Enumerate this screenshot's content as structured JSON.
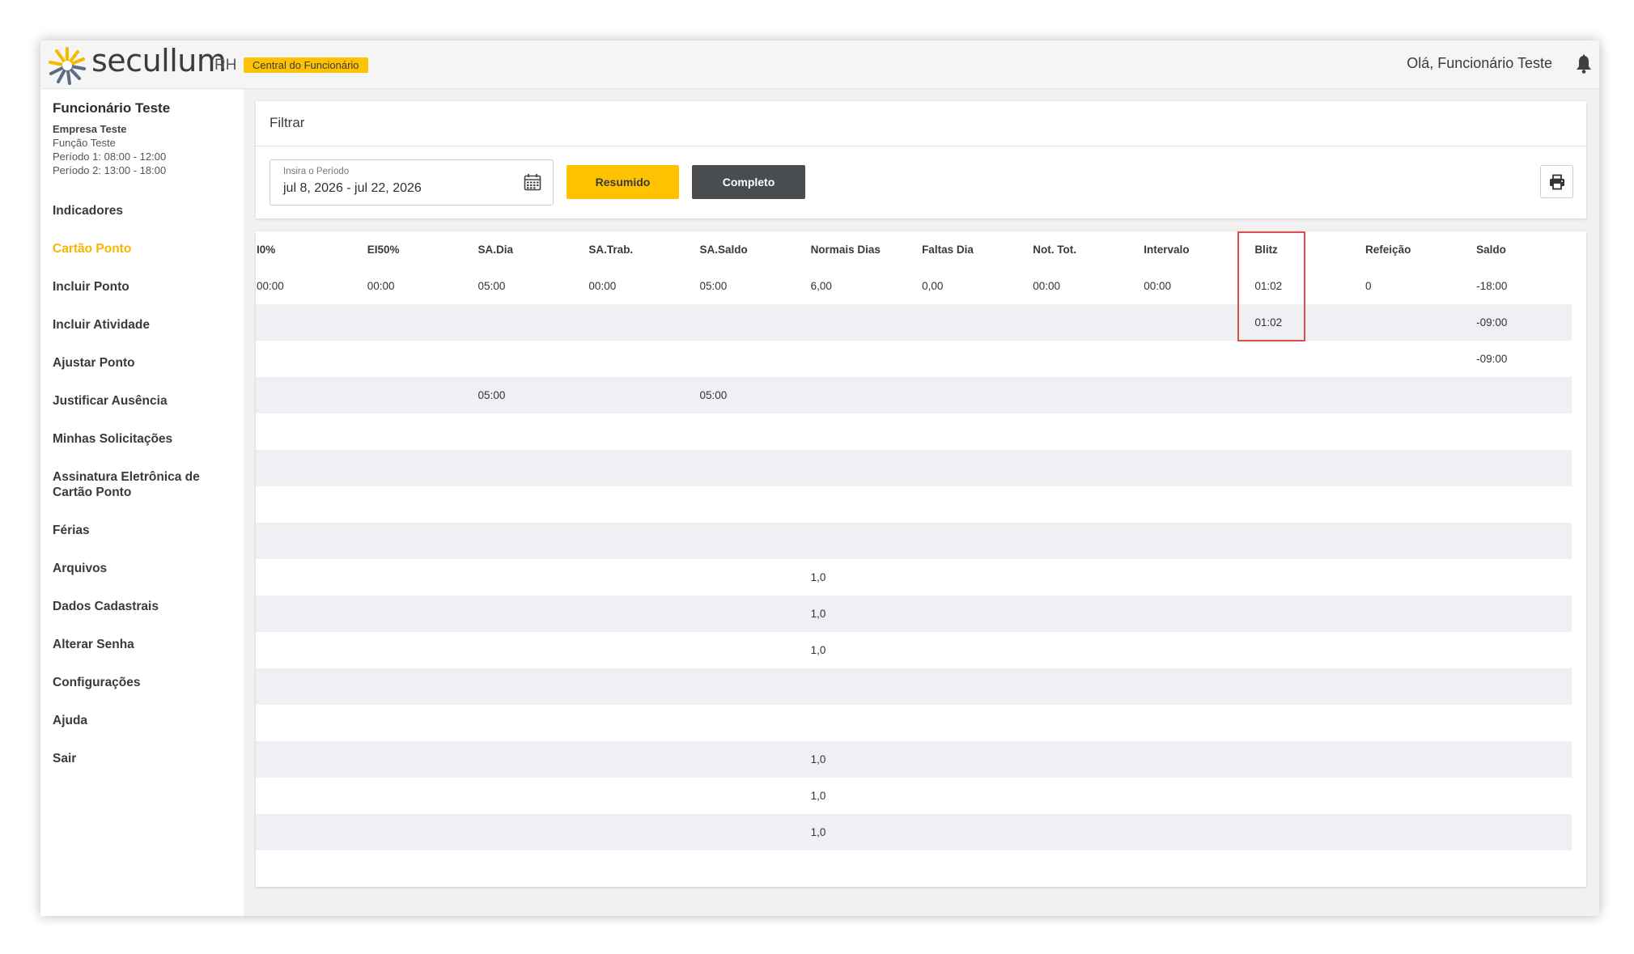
{
  "header": {
    "brand": "secullum",
    "brand_suffix": "RH",
    "badge": "Central do Funcionário",
    "greeting": "Olá, Funcionário Teste",
    "logo_icon": "secullum-starburst-logo",
    "bell_icon": "bell-icon"
  },
  "employee": {
    "name": "Funcionário Teste",
    "company": "Empresa Teste",
    "function": "Função Teste",
    "period1": "Período 1: 08:00 - 12:00",
    "period2": "Período 2: 13:00 - 18:00"
  },
  "nav": {
    "items": [
      {
        "label": "Indicadores",
        "active": false
      },
      {
        "label": "Cartão Ponto",
        "active": true
      },
      {
        "label": "Incluir Ponto",
        "active": false
      },
      {
        "label": "Incluir Atividade",
        "active": false
      },
      {
        "label": "Ajustar Ponto",
        "active": false
      },
      {
        "label": "Justificar Ausência",
        "active": false
      },
      {
        "label": "Minhas Solicitações",
        "active": false
      },
      {
        "label": "Assinatura Eletrônica de Cartão Ponto",
        "active": false
      },
      {
        "label": "Férias",
        "active": false
      },
      {
        "label": "Arquivos",
        "active": false
      },
      {
        "label": "Dados Cadastrais",
        "active": false
      },
      {
        "label": "Alterar Senha",
        "active": false
      },
      {
        "label": "Configurações",
        "active": false
      },
      {
        "label": "Ajuda",
        "active": false
      },
      {
        "label": "Sair",
        "active": false
      }
    ]
  },
  "filter": {
    "title": "Filtrar",
    "period_placeholder": "Insira o Período",
    "period_value": "jul 8, 2026 - jul 22, 2026",
    "btn_resumido": "Resumido",
    "btn_completo": "Completo"
  },
  "table": {
    "columns": [
      "I0%",
      "EI50%",
      "SA.Dia",
      "SA.Trab.",
      "SA.Saldo",
      "Normais Dias",
      "Faltas Dia",
      "Not. Tot.",
      "Intervalo",
      "Blitz",
      "Refeição",
      "Saldo"
    ],
    "rows": [
      [
        "00:00",
        "00:00",
        "05:00",
        "00:00",
        "05:00",
        "6,00",
        "0,00",
        "00:00",
        "00:00",
        "01:02",
        "0",
        "-18:00"
      ],
      [
        "",
        "",
        "",
        "",
        "",
        "",
        "",
        "",
        "",
        "01:02",
        "",
        "-09:00"
      ],
      [
        "",
        "",
        "",
        "",
        "",
        "",
        "",
        "",
        "",
        "",
        "",
        "-09:00"
      ],
      [
        "",
        "",
        "05:00",
        "",
        "05:00",
        "",
        "",
        "",
        "",
        "",
        "",
        ""
      ],
      [
        "",
        "",
        "",
        "",
        "",
        "",
        "",
        "",
        "",
        "",
        "",
        ""
      ],
      [
        "",
        "",
        "",
        "",
        "",
        "",
        "",
        "",
        "",
        "",
        "",
        ""
      ],
      [
        "",
        "",
        "",
        "",
        "",
        "",
        "",
        "",
        "",
        "",
        "",
        ""
      ],
      [
        "",
        "",
        "",
        "",
        "",
        "",
        "",
        "",
        "",
        "",
        "",
        ""
      ],
      [
        "",
        "",
        "",
        "",
        "",
        "1,0",
        "",
        "",
        "",
        "",
        "",
        ""
      ],
      [
        "",
        "",
        "",
        "",
        "",
        "1,0",
        "",
        "",
        "",
        "",
        "",
        ""
      ],
      [
        "",
        "",
        "",
        "",
        "",
        "1,0",
        "",
        "",
        "",
        "",
        "",
        ""
      ],
      [
        "",
        "",
        "",
        "",
        "",
        "",
        "",
        "",
        "",
        "",
        "",
        ""
      ],
      [
        "",
        "",
        "",
        "",
        "",
        "",
        "",
        "",
        "",
        "",
        "",
        ""
      ],
      [
        "",
        "",
        "",
        "",
        "",
        "1,0",
        "",
        "",
        "",
        "",
        "",
        ""
      ],
      [
        "",
        "",
        "",
        "",
        "",
        "1,0",
        "",
        "",
        "",
        "",
        "",
        ""
      ],
      [
        "",
        "",
        "",
        "",
        "",
        "1,0",
        "",
        "",
        "",
        "",
        "",
        ""
      ]
    ]
  },
  "colors": {
    "accent": "#ffc200",
    "active_nav": "#f7b500",
    "dark_button": "#4a4d50",
    "highlight_border": "#e04b4b"
  }
}
